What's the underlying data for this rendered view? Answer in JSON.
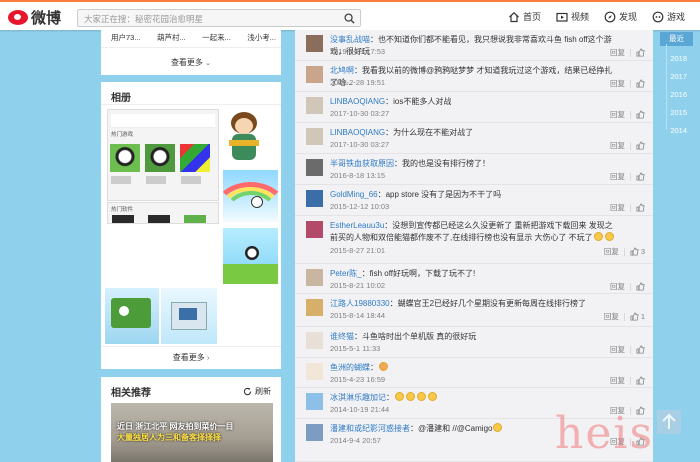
{
  "header": {
    "logo_text": "微博",
    "search_placeholder": "大家正在搜：秘密花园治愈明星",
    "nav": [
      {
        "label": "首页",
        "icon": "home-icon"
      },
      {
        "label": "视频",
        "icon": "video-icon"
      },
      {
        "label": "发现",
        "icon": "compass-icon"
      },
      {
        "label": "游戏",
        "icon": "gamepad-icon"
      }
    ]
  },
  "top_card": {
    "users": [
      "用户73...",
      "葫芦村...",
      "一起来...",
      "浅小考..."
    ],
    "more_label": "查看更多"
  },
  "album": {
    "title": "相册",
    "section1_label": "热门游戏",
    "section2_label": "热门软件",
    "more_label": "查看更多"
  },
  "recommend": {
    "title": "相关推荐",
    "refresh_label": "刷新",
    "caption_line1": "近日 浙江北平 网友拍到菜价一目",
    "caption_line2": "大量独居人为三和备客择择择"
  },
  "comments": [
    {
      "name": "没事乱战喵",
      "text": "：也不知道你们都不能看见，我只想说我非常喜欢斗鱼 fish off这个游戏，很好玩",
      "time": "2019-3-21 17:53",
      "likes": "",
      "name_color": "blue"
    },
    {
      "name": "北鸠啊",
      "text": "：我看我以前的微博@鸦鸦哒梦梦 才知道我玩过这个游戏，结果已经挣扎了哈...",
      "time": "2018-2-28 19:51",
      "likes": "",
      "name_color": "blue"
    },
    {
      "name": "LINBAOQIANG",
      "text": "：ios不能多人对战",
      "time": "2017-10-30 03:27",
      "likes": "",
      "name_color": "blue"
    },
    {
      "name": "LINBAOQIANG",
      "text": "：为什么现在不能对战了",
      "time": "2017-10-30 03:27",
      "likes": "",
      "name_color": "blue"
    },
    {
      "name": "半哥铁血获取原因",
      "text": "：我的也是没有排行榜了！",
      "time": "2016-8-18 13:15",
      "likes": "",
      "name_color": "blue"
    },
    {
      "name": "GoldMing_66",
      "text": "：app store 没有了是因为不干了吗",
      "time": "2015-12-12 10:03",
      "likes": "",
      "name_color": "blue"
    },
    {
      "name": "EstherLeauu3u",
      "text": "：没想到宣传都已经这么久没更新了 重新把游戏下载回来 发现之前买的人物和双倍能猫都作废不了,在线排行榜也没有显示 大伤心了 不玩了",
      "time": "2015-8-27 21:01",
      "likes": "3",
      "name_color": "blue"
    },
    {
      "name": "Peter陈_",
      "text": "：fish off好玩啊，下载了玩不了!",
      "time": "2015-8-21 10:02",
      "likes": "",
      "name_color": "blue"
    },
    {
      "name": "江路人19880330",
      "text": "：蝴蝶官王2已经好几个星期没有更新每周在线排行榜了",
      "time": "2015-8-14 18:44",
      "likes": "1",
      "name_color": "blue"
    },
    {
      "name": "谁终猫",
      "text": "：斗鱼啥时出个单机版 真的很好玩",
      "time": "2015-5-1 11:33",
      "likes": "",
      "name_color": "blue"
    },
    {
      "name": "鱼洲的蝴蝶",
      "text": "：",
      "time": "2015-4-23 16:59",
      "likes": "",
      "name_color": "blue"
    },
    {
      "name": "冰淇淋乐趣加记",
      "text": "：",
      "time": "2014-10-19 21:44",
      "likes": "",
      "name_color": "blue"
    },
    {
      "name": "潘建和或纪影河惑接者",
      "text": "：@潘建和 //@Camigo",
      "time": "2014-9-4 20:57",
      "likes": "",
      "name_color": "blue"
    }
  ],
  "comment_ops": {
    "reply": "回复"
  },
  "timeline": {
    "active_label": "最近",
    "years": [
      "2018",
      "2017",
      "2016",
      "2015",
      "2014"
    ]
  },
  "watermark": "heis"
}
